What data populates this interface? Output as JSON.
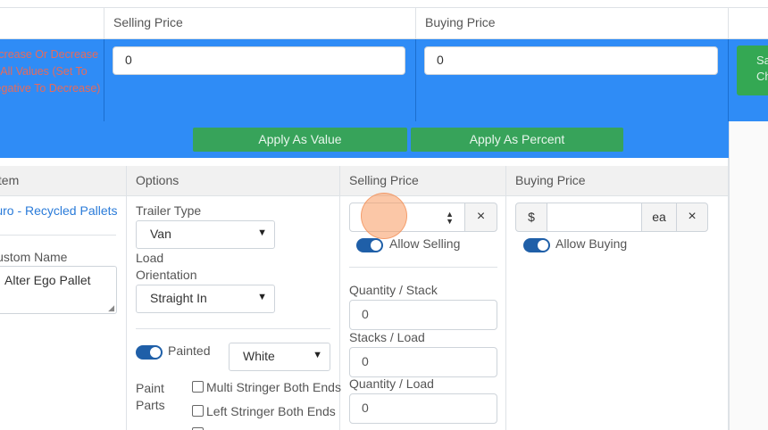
{
  "header": {
    "selling_price": "Selling Price",
    "buying_price": "Buying Price"
  },
  "adjust": {
    "note": "Increase Or Decrease All Values (Set To Negative To Decrease)",
    "selling_value": "0",
    "buying_value": "0",
    "save_label": "Save Changes",
    "apply_value_label": "Apply As Value",
    "apply_percent_label": "Apply As Percent"
  },
  "table": {
    "col_item": "Item",
    "col_options": "Options",
    "col_selling": "Selling Price",
    "col_buying": "Buying Price"
  },
  "row": {
    "item_link": "Euro - Recycled Pallets",
    "custom_name_label": "Custom Name",
    "custom_name_value": "Alter Ego Pallet",
    "trailer_type_label": "Trailer Type",
    "trailer_type_value": "Van",
    "load_orientation_label": "Load Orientation",
    "load_orientation_value": "Straight In",
    "painted_label": "Painted",
    "paint_color_value": "White",
    "paint_parts_label": "Paint Parts",
    "paint_parts": [
      "Multi Stringer Both Ends",
      "Left Stringer Both Ends"
    ],
    "sell_clear": "×",
    "allow_selling_label": "Allow Selling",
    "quantity_stack_label": "Quantity / Stack",
    "quantity_stack_value": "0",
    "stacks_load_label": "Stacks / Load",
    "stacks_load_value": "0",
    "quantity_load_label": "Quantity / Load",
    "quantity_load_value": "0",
    "buy_currency": "$",
    "buy_unit": "ea",
    "buy_clear": "×",
    "allow_buying_label": "Allow Buying"
  },
  "colors": {
    "band": "#2f8cf6",
    "apply": "#37a35a",
    "link": "#2a7bd9",
    "toggle": "#1f5fa8"
  }
}
